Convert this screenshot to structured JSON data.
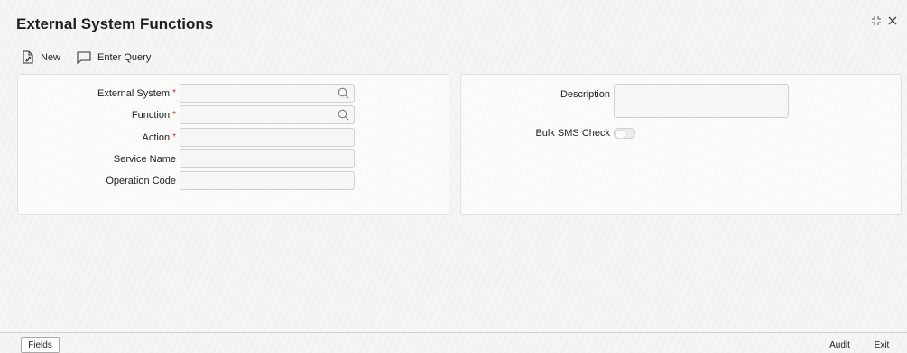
{
  "window": {
    "title": "External System Functions"
  },
  "toolbar": {
    "new_label": "New",
    "enter_query_label": "Enter Query"
  },
  "left_panel": {
    "external_system": {
      "label": "External System",
      "required": "*",
      "value": ""
    },
    "function": {
      "label": "Function",
      "required": "*",
      "value": ""
    },
    "action": {
      "label": "Action",
      "required": "*",
      "value": ""
    },
    "service_name": {
      "label": "Service Name",
      "value": ""
    },
    "operation_code": {
      "label": "Operation Code",
      "value": ""
    }
  },
  "right_panel": {
    "description": {
      "label": "Description",
      "value": ""
    },
    "bulk_sms_check": {
      "label": "Bulk SMS Check",
      "checked": false
    }
  },
  "footer": {
    "fields_label": "Fields",
    "audit_label": "Audit",
    "exit_label": "Exit"
  },
  "icons": {
    "new": "new-document-icon",
    "enter_query": "comment-icon",
    "search": "search-icon",
    "minimize": "collapse-icon",
    "close": "close-icon"
  }
}
